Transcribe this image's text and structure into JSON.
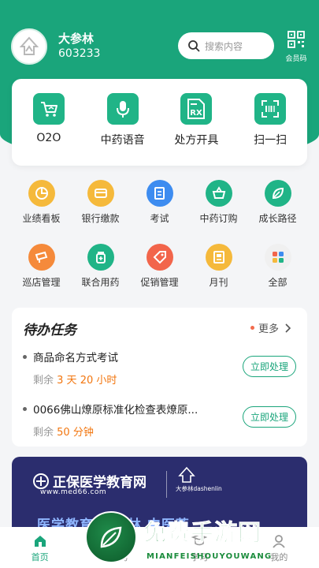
{
  "user": {
    "name": "大参林",
    "id": "603233"
  },
  "search": {
    "placeholder": "搜索内容"
  },
  "member_code": {
    "label": "会员码"
  },
  "main_features": [
    {
      "label": "O2O",
      "icon": "shopping-cart-icon"
    },
    {
      "label": "中药语音",
      "icon": "microphone-icon"
    },
    {
      "label": "处方开具",
      "icon": "prescription-rx-icon"
    },
    {
      "label": "扫一扫",
      "icon": "scan-icon"
    }
  ],
  "grid_row1": [
    {
      "label": "业绩看板",
      "icon": "pie-chart-icon",
      "color": "#f5b93b"
    },
    {
      "label": "银行缴款",
      "icon": "bank-card-icon",
      "color": "#f5b93b"
    },
    {
      "label": "考试",
      "icon": "exam-paper-icon",
      "color": "#3d8cf0"
    },
    {
      "label": "中药订购",
      "icon": "basket-icon",
      "color": "#20b487"
    },
    {
      "label": "成长路径",
      "icon": "leaf-icon",
      "color": "#20b487"
    }
  ],
  "grid_row2": [
    {
      "label": "巡店管理",
      "icon": "cctv-camera-icon",
      "color": "#f58a3b"
    },
    {
      "label": "联合用药",
      "icon": "medicine-bottle-icon",
      "color": "#20b487"
    },
    {
      "label": "促销管理",
      "icon": "price-tag-icon",
      "color": "#f2654b"
    },
    {
      "label": "月刊",
      "icon": "magazine-icon",
      "color": "#f5b93b"
    },
    {
      "label": "全部",
      "icon": "all-apps-icon",
      "color": "#f0f0f0"
    }
  ],
  "todo": {
    "title": "待办任务",
    "more_label": "更多",
    "remain_prefix": "剩余",
    "tasks": [
      {
        "name": "商品命名方式考试",
        "remain": "3 天 20 小时",
        "action": "立即处理"
      },
      {
        "name": "0066佛山燎原标准化检查表燎原...",
        "remain": "50 分钟",
        "action": "立即处理"
      }
    ]
  },
  "banner": {
    "brand": "正保医学教育网",
    "site": "www.med66.com",
    "partner": "大参林dashenlin",
    "headline": "医学教育 大参林 中医药"
  },
  "tabs": [
    {
      "label": "首页",
      "icon": "home-icon",
      "active": true
    },
    {
      "label": "任务",
      "icon": "task-icon"
    },
    {
      "label": "学习",
      "icon": "study-icon"
    },
    {
      "label": "我的",
      "icon": "profile-icon"
    }
  ],
  "watermark": {
    "text": "免费手游网",
    "sub": "MIANFEISHOUYOUWANG"
  },
  "colors": {
    "brand_green": "#1aa57b",
    "accent_orange": "#f2760f"
  }
}
